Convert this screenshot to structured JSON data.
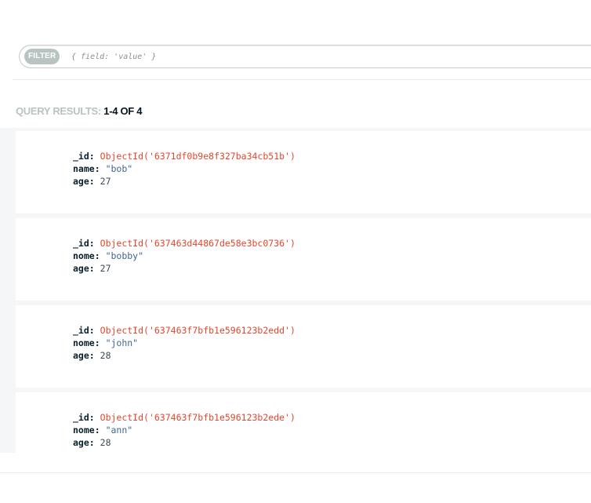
{
  "filter": {
    "label": "FILTER",
    "placeholder": "{ field: 'value' }"
  },
  "results": {
    "label": "QUERY RESULTS:",
    "range": "1-4 OF 4"
  },
  "documents": [
    {
      "id": {
        "key": "_id",
        "value": "ObjectId('6371df0b9e8f327ba34cb51b')"
      },
      "field": {
        "key": "name",
        "value": "\"bob\""
      },
      "age": {
        "key": "age",
        "value": "27"
      }
    },
    {
      "id": {
        "key": "_id",
        "value": "ObjectId('637463d44867de58e3bc0736')"
      },
      "field": {
        "key": "nome",
        "value": "\"bobby\""
      },
      "age": {
        "key": "age",
        "value": "27"
      }
    },
    {
      "id": {
        "key": "_id",
        "value": "ObjectId('637463f7bfb1e596123b2edd')"
      },
      "field": {
        "key": "nome",
        "value": "\"john\""
      },
      "age": {
        "key": "age",
        "value": "28"
      }
    },
    {
      "id": {
        "key": "_id",
        "value": "ObjectId('637463f7bfb1e596123b2ede')"
      },
      "field": {
        "key": "nome",
        "value": "\"ann\""
      },
      "age": {
        "key": "age",
        "value": "28"
      }
    }
  ]
}
